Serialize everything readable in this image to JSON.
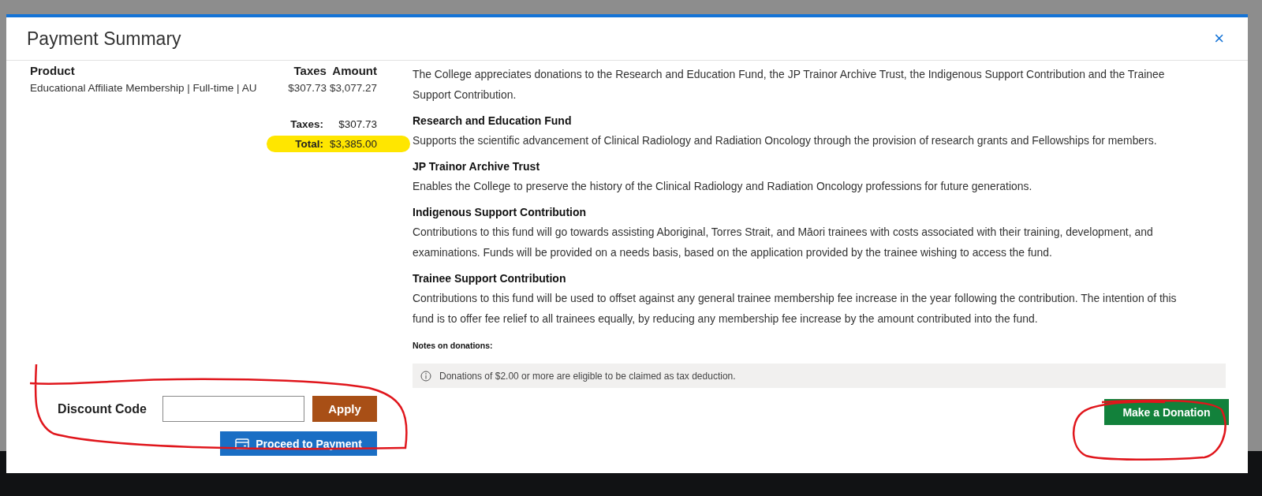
{
  "dialog": {
    "title": "Payment Summary",
    "close": "×"
  },
  "order": {
    "columns": [
      "Product",
      "Taxes",
      "Amount"
    ],
    "rows": [
      {
        "product": "Educational Affiliate Membership | Full-time | AU",
        "taxes": "$307.73",
        "amount": "$3,077.27"
      }
    ],
    "totals": [
      {
        "label": "Taxes:",
        "value": "$307.73",
        "highlighted": false
      },
      {
        "label": "Total:",
        "value": "$3,385.00",
        "highlighted": true
      }
    ]
  },
  "discount": {
    "label": "Discount Code",
    "apply": "Apply"
  },
  "proceed": "Proceed to Payment",
  "donations": {
    "intro": "The College appreciates donations to the Research and Education Fund, the JP Trainor Archive Trust, the Indigenous Support Contribution and the Trainee Support Contribution.",
    "funds": [
      {
        "title": "Research and Education Fund",
        "text": "Supports the scientific advancement of Clinical Radiology and Radiation Oncology through the provision of research grants and Fellowships for members."
      },
      {
        "title": "JP Trainor Archive Trust",
        "text": "Enables the College to preserve the history of the Clinical Radiology and Radiation Oncology professions for future generations."
      },
      {
        "title": "Indigenous Support Contribution",
        "text": "Contributions to this fund will go towards assisting Aboriginal, Torres Strait, and Māori trainees with costs associated with their training, development, and examinations. Funds will be provided on a needs basis, based on the application provided by the trainee wishing to access the fund."
      },
      {
        "title": "Trainee Support Contribution",
        "text": "Contributions to this fund will be used to offset against any general trainee membership fee increase in the year following the contribution. The intention of this fund is to offer fee relief to all trainees equally, by reducing any membership fee increase by the amount contributed into the fund."
      }
    ],
    "notes_title": "Notes on donations:",
    "note": "Donations of $2.00 or more are eligible to be claimed as tax deduction.",
    "button": "Make a Donation"
  }
}
